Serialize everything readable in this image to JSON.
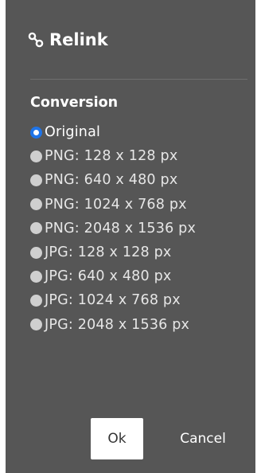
{
  "dialog": {
    "title": "Relink",
    "title_icon": "link-icon",
    "section_label": "Conversion",
    "options": [
      {
        "label": "Original",
        "selected": true
      },
      {
        "label": "PNG: 128 x 128 px",
        "selected": false
      },
      {
        "label": "PNG: 640 x 480 px",
        "selected": false
      },
      {
        "label": "PNG: 1024 x 768 px",
        "selected": false
      },
      {
        "label": "PNG: 2048 x 1536 px",
        "selected": false
      },
      {
        "label": "JPG: 128 x 128 px",
        "selected": false
      },
      {
        "label": "JPG: 640 x 480 px",
        "selected": false
      },
      {
        "label": "JPG: 1024 x 768 px",
        "selected": false
      },
      {
        "label": "JPG: 2048 x 1536 px",
        "selected": false
      }
    ],
    "ok_label": "Ok",
    "cancel_label": "Cancel"
  },
  "colors": {
    "panel_background": "#565656",
    "accent": "#1f74e8",
    "radio_unselected": "#cfcfcf",
    "text": "#ffffff"
  }
}
